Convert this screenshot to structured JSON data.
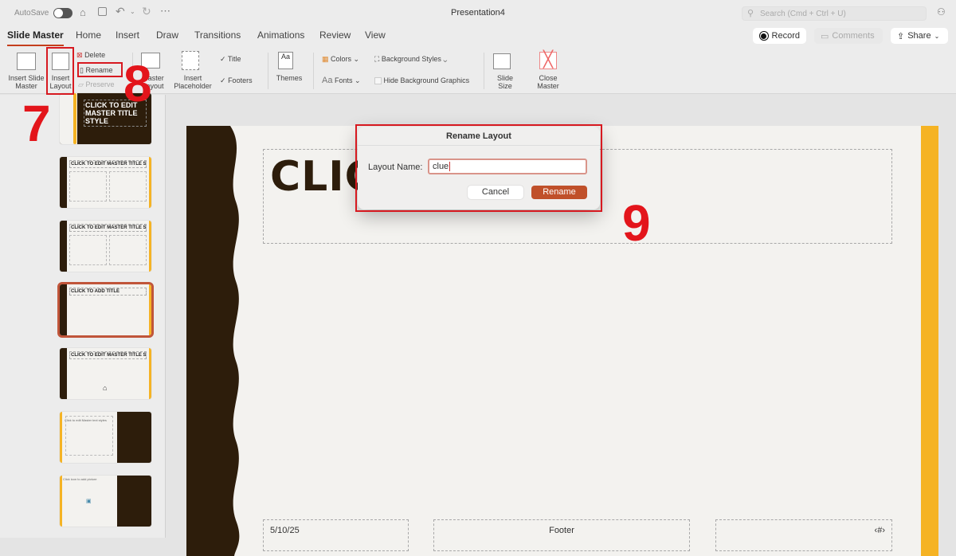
{
  "titlebar": {
    "autosave": "AutoSave",
    "title": "Presentation4",
    "search_placeholder": "Search (Cmd + Ctrl + U)"
  },
  "tabs": [
    "Slide Master",
    "Home",
    "Insert",
    "Draw",
    "Transitions",
    "Animations",
    "Review",
    "View"
  ],
  "actions": {
    "record": "Record",
    "comments": "Comments",
    "share": "Share"
  },
  "ribbon": {
    "insert_slide_master": [
      "Insert Slide",
      "Master"
    ],
    "insert_layout": [
      "Insert",
      "Layout"
    ],
    "delete": "Delete",
    "rename": "Rename",
    "preserve": "Preserve",
    "master_layout": [
      "Master",
      "Layout"
    ],
    "insert_placeholder": [
      "Insert",
      "Placeholder"
    ],
    "title": "Title",
    "footers": "Footers",
    "themes": "Themes",
    "colors": "Colors",
    "background_styles": "Background Styles",
    "fonts": "Fonts",
    "hide_background_graphics": "Hide Background Graphics",
    "slide_size": [
      "Slide",
      "Size"
    ],
    "close_master": [
      "Close",
      "Master"
    ]
  },
  "thumbnails": [
    {
      "title": "CLICK TO EDIT MASTER TITLE STYLE",
      "kind": "master"
    },
    {
      "title": "CLICK TO EDIT MASTER TITLE STYLE",
      "kind": "two-content"
    },
    {
      "title": "CLICK TO EDIT MASTER TITLE STYLE",
      "kind": "comparison"
    },
    {
      "title": "CLICK TO ADD TITLE",
      "kind": "title-only",
      "selected": true
    },
    {
      "title": "CLICK TO EDIT MASTER TITLE STYLE",
      "kind": "blank"
    },
    {
      "title": "Click to edit Master text styles",
      "kind": "content-caption"
    },
    {
      "title": "Click icon to add picture",
      "kind": "picture-caption"
    }
  ],
  "slide": {
    "title_partial": "CLICK",
    "date": "5/10/25",
    "footer": "Footer",
    "page_number": "‹#›"
  },
  "dialog": {
    "title": "Rename Layout",
    "label": "Layout Name:",
    "value": "clue",
    "cancel": "Cancel",
    "rename": "Rename"
  },
  "annotations": [
    "7",
    "8",
    "9"
  ],
  "colors": {
    "accent": "#c43e1c",
    "brown": "#2d1d0b",
    "yellow": "#f5b324",
    "annotation": "#e3151b"
  }
}
